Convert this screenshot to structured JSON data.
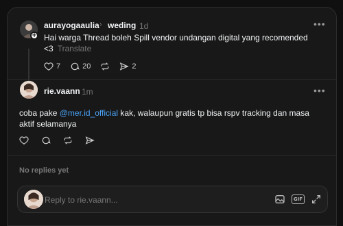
{
  "original_post": {
    "username": "aurayogaaulia",
    "topic": "weding",
    "time": "1d",
    "text": "Hai warga Thread boleh Spill vendor undangan digital yang recomended",
    "text_cont": "<3",
    "translate_label": "Translate",
    "likes": "7",
    "comments": "20",
    "shares": "2",
    "more_label": "•••"
  },
  "reply": {
    "username": "rie.vaann",
    "time": "1m",
    "text_before": "coba pake ",
    "mention": "@mer.id_official",
    "text_after": " kak, walaupun gratis tp bisa rspv tracking dan masa",
    "text_line2": "aktif selamanya",
    "more_label": "•••"
  },
  "no_replies_label": "No replies yet",
  "reply_box": {
    "placeholder": "Reply to rie.vaann..."
  },
  "colors": {
    "background": "#101010",
    "panel": "#181818",
    "mention": "#4aa3f7",
    "muted": "#777777"
  }
}
